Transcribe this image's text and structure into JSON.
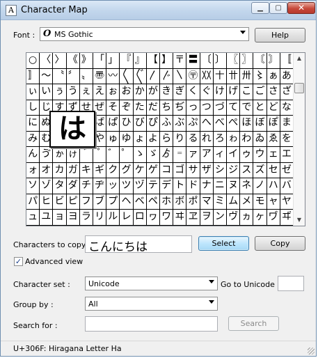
{
  "window": {
    "title": "Character Map",
    "icon_glyph": "A"
  },
  "font": {
    "label": "Font :",
    "value": "MS Gothic",
    "font_icon": "opentype-icon",
    "help_label": "Help"
  },
  "grid": {
    "rows": [
      [
        "○",
        "〈",
        "〉",
        "《",
        "》",
        "「",
        "」",
        "『",
        "』",
        "【",
        "】",
        "〒",
        "〓",
        "〔",
        "〕",
        "〖",
        "〗",
        "〘",
        "〙",
        "〚"
      ],
      [
        "〛",
        "〜",
        "〝",
        "〞",
        "〟",
        "〠",
        "〰",
        "〱",
        "〲",
        "〳",
        "〴",
        "〵",
        "〶",
        "〷",
        "〸",
        "〹",
        "〺",
        "〻",
        "ぁ",
        "あ"
      ],
      [
        "ぃ",
        "い",
        "ぅ",
        "う",
        "ぇ",
        "え",
        "ぉ",
        "お",
        "か",
        "が",
        "き",
        "ぎ",
        "く",
        "ぐ",
        "け",
        "げ",
        "こ",
        "ご",
        "さ",
        "ざ"
      ],
      [
        "し",
        "じ",
        "す",
        "ず",
        "せ",
        "ぜ",
        "そ",
        "ぞ",
        "た",
        "だ",
        "ち",
        "ぢ",
        "っ",
        "つ",
        "づ",
        "て",
        "で",
        "と",
        "ど",
        "な"
      ],
      [
        "に",
        "ぬ",
        "ね",
        "の",
        "は",
        "ば",
        "ぱ",
        "ひ",
        "び",
        "ぴ",
        "ふ",
        "ぶ",
        "ぷ",
        "へ",
        "べ",
        "ぺ",
        "ほ",
        "ぼ",
        "ぽ",
        "ま"
      ],
      [
        "み",
        "む",
        "め",
        "も",
        "ゃ",
        "や",
        "ゅ",
        "ゆ",
        "ょ",
        "よ",
        "ら",
        "り",
        "る",
        "れ",
        "ろ",
        "ゎ",
        "わ",
        "ゐ",
        "ゑ",
        "を"
      ],
      [
        "ん",
        "ゔ",
        "ゕ",
        "ゖ",
        "゙",
        "゚",
        "゛",
        "゜",
        "ゝ",
        "ゞ",
        "ゟ",
        "゠",
        "ァ",
        "ア",
        "ィ",
        "イ",
        "ゥ",
        "ウ",
        "ェ",
        "エ"
      ],
      [
        "ォ",
        "オ",
        "カ",
        "ガ",
        "キ",
        "ギ",
        "ク",
        "グ",
        "ケ",
        "ゲ",
        "コ",
        "ゴ",
        "サ",
        "ザ",
        "シ",
        "ジ",
        "ス",
        "ズ",
        "セ",
        "ゼ"
      ],
      [
        "ソ",
        "ゾ",
        "タ",
        "ダ",
        "チ",
        "ヂ",
        "ッ",
        "ツ",
        "ヅ",
        "テ",
        "デ",
        "ト",
        "ド",
        "ナ",
        "ニ",
        "ヌ",
        "ネ",
        "ノ",
        "ハ",
        "バ"
      ],
      [
        "パ",
        "ヒ",
        "ビ",
        "ピ",
        "フ",
        "ブ",
        "プ",
        "ヘ",
        "ベ",
        "ペ",
        "ホ",
        "ボ",
        "ポ",
        "マ",
        "ミ",
        "ム",
        "メ",
        "モ",
        "ャ",
        "ヤ"
      ],
      [
        "ュ",
        "ユ",
        "ョ",
        "ヨ",
        "ラ",
        "リ",
        "ル",
        "レ",
        "ロ",
        "ヮ",
        "ワ",
        "ヰ",
        "ヱ",
        "ヲ",
        "ン",
        "ヴ",
        "ヵ",
        "ヶ",
        "ヷ",
        "ヸ"
      ]
    ],
    "magnified_char": "は"
  },
  "copy": {
    "label": "Characters to copy",
    "value": "こんにちは",
    "select_label": "Select",
    "copy_label": "Copy"
  },
  "advanced": {
    "label": "Advanced view",
    "checked_glyph": "✓"
  },
  "charset": {
    "label": "Character set :",
    "value": "Unicode",
    "goto_label": "Go to Unicode :"
  },
  "groupby": {
    "label": "Group by :",
    "value": "All"
  },
  "search": {
    "label": "Search for :",
    "button_label": "Search"
  },
  "status": {
    "text": "U+306F: Hiragana Letter Ha"
  },
  "colors": {
    "accent": "#3c7fb1",
    "close_button": "#c6483a"
  }
}
